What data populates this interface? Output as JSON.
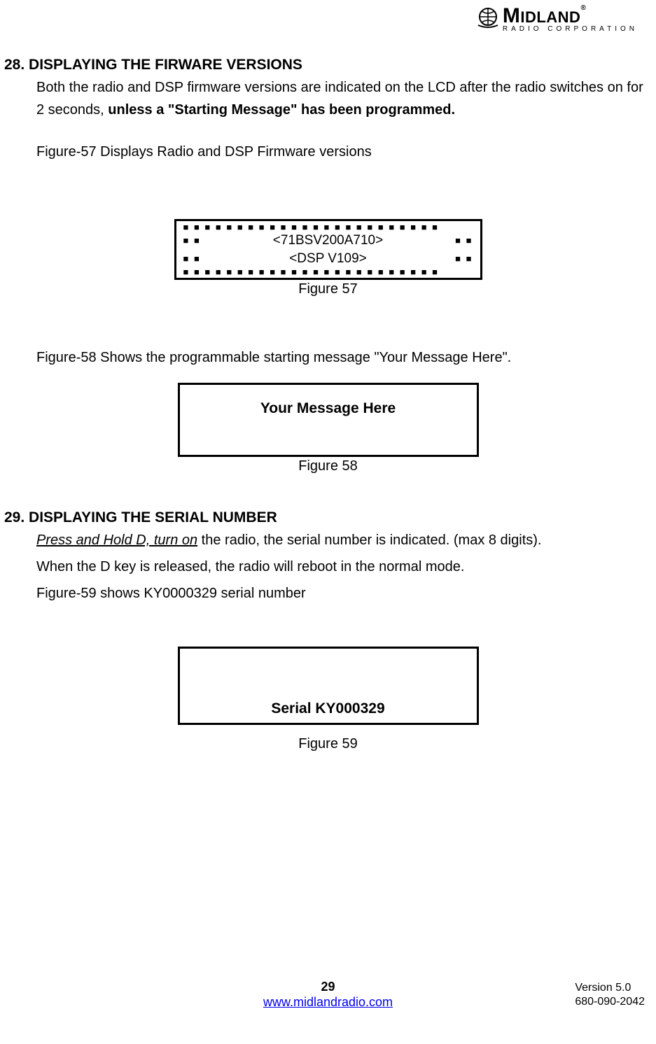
{
  "logo": {
    "brand_letter": "M",
    "brand_rest": "IDLAND",
    "registered": "®",
    "subline": "RADIO CORPORATION"
  },
  "section28": {
    "title": "28. DISPLAYING THE FIRWARE VERSIONS",
    "body_part1": "Both the radio and DSP firmware versions are indicated on the LCD after the radio switches on for 2 seconds, ",
    "body_bold_tail": "unless a \"Starting Message\" has been programmed.",
    "fig57_intro": "Figure-57 Displays Radio and DSP Firmware versions",
    "lcd_row1": "<71BSV200A710>",
    "lcd_row2": "<DSP V109>",
    "fig57_caption": "Figure 57",
    "fig58_intro": "Figure-58 Shows the programmable starting message \"Your Message Here\".",
    "msgbox_text": "Your Message Here",
    "fig58_caption": "Figure 58"
  },
  "section29": {
    "title": "29. DISPLAYING THE SERIAL NUMBER",
    "line1_underlined": "Press and Hold D, turn on",
    "line1_rest": " the radio, the serial number is indicated. (max 8 digits).",
    "line2": "When the D key is released, the radio will reboot in the normal mode.",
    "line3": "Figure-59 shows KY0000329 serial number",
    "serial_text": "Serial   KY000329",
    "fig59_caption": "Figure 59"
  },
  "footer": {
    "page": "29",
    "url": "www.midlandradio.com",
    "version": "Version 5.0",
    "docnum": "680-090-2042"
  }
}
